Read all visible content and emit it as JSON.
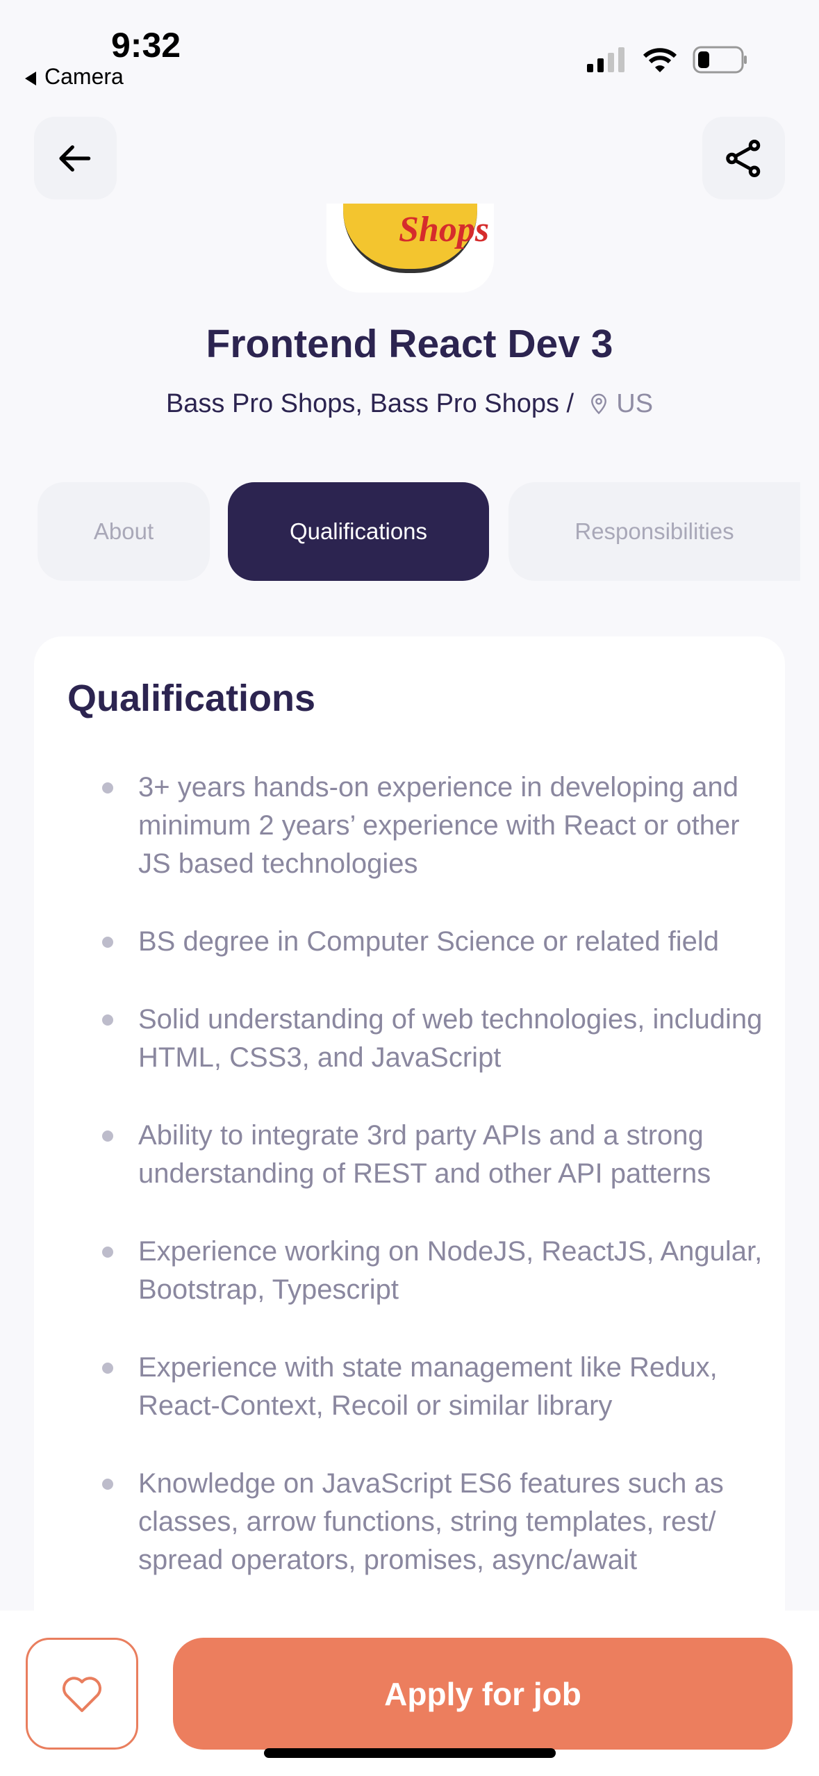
{
  "status_bar": {
    "time": "9:32",
    "back_app": "Camera"
  },
  "job": {
    "title": "Frontend React Dev 3",
    "company": "Bass Pro Shops, Bass Pro Shops /",
    "location": "US",
    "logo_text": "Shops"
  },
  "tabs": [
    {
      "label": "About",
      "active": false
    },
    {
      "label": "Qualifications",
      "active": true
    },
    {
      "label": "Responsibilities",
      "active": false
    }
  ],
  "section": {
    "heading": "Qualifications",
    "items": [
      "3+ years hands-on experience in developing and minimum 2 years’ experience with React or other JS based technologies",
      "BS degree in Computer Science or related field",
      "Solid understanding of web technologies, including HTML, CSS3, and JavaScript",
      "Ability to integrate 3rd party APIs and a strong understanding of REST and other API patterns",
      "Experience working on NodeJS, ReactJS, Angular, Bootstrap, Typescript",
      "Experience with state management like Redux, React-Context, Recoil or similar library",
      "Knowledge on JavaScript ES6 features such as classes, arrow functions, string templates, rest/ spread operators, promises, async/await"
    ]
  },
  "actions": {
    "apply_label": "Apply for job"
  },
  "colors": {
    "primary": "#2c2450",
    "accent": "#ec7e5e"
  }
}
